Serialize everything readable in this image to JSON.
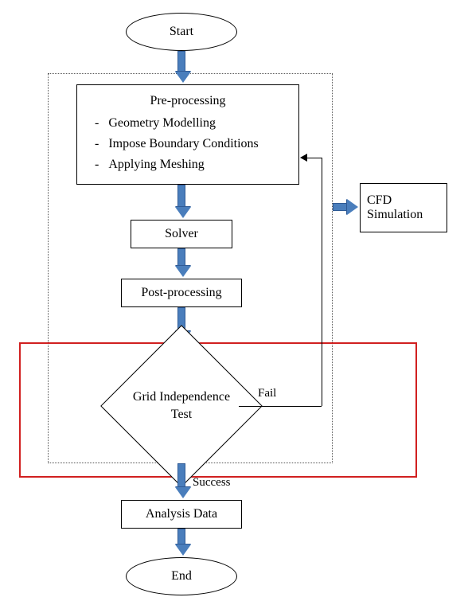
{
  "flow": {
    "start": "Start",
    "preprocessing": {
      "title": "Pre-processing",
      "items": [
        "Geometry Modelling",
        "Impose Boundary Conditions",
        "Applying Meshing"
      ]
    },
    "solver": "Solver",
    "postprocessing": "Post-processing",
    "decision": {
      "label": "Grid Independence Test",
      "fail": "Fail",
      "success": "Success"
    },
    "analysis": "Analysis Data",
    "end": "End",
    "side_box": "CFD Simulation"
  },
  "colors": {
    "arrow": "#4a7ebc",
    "highlight": "#d12020"
  }
}
